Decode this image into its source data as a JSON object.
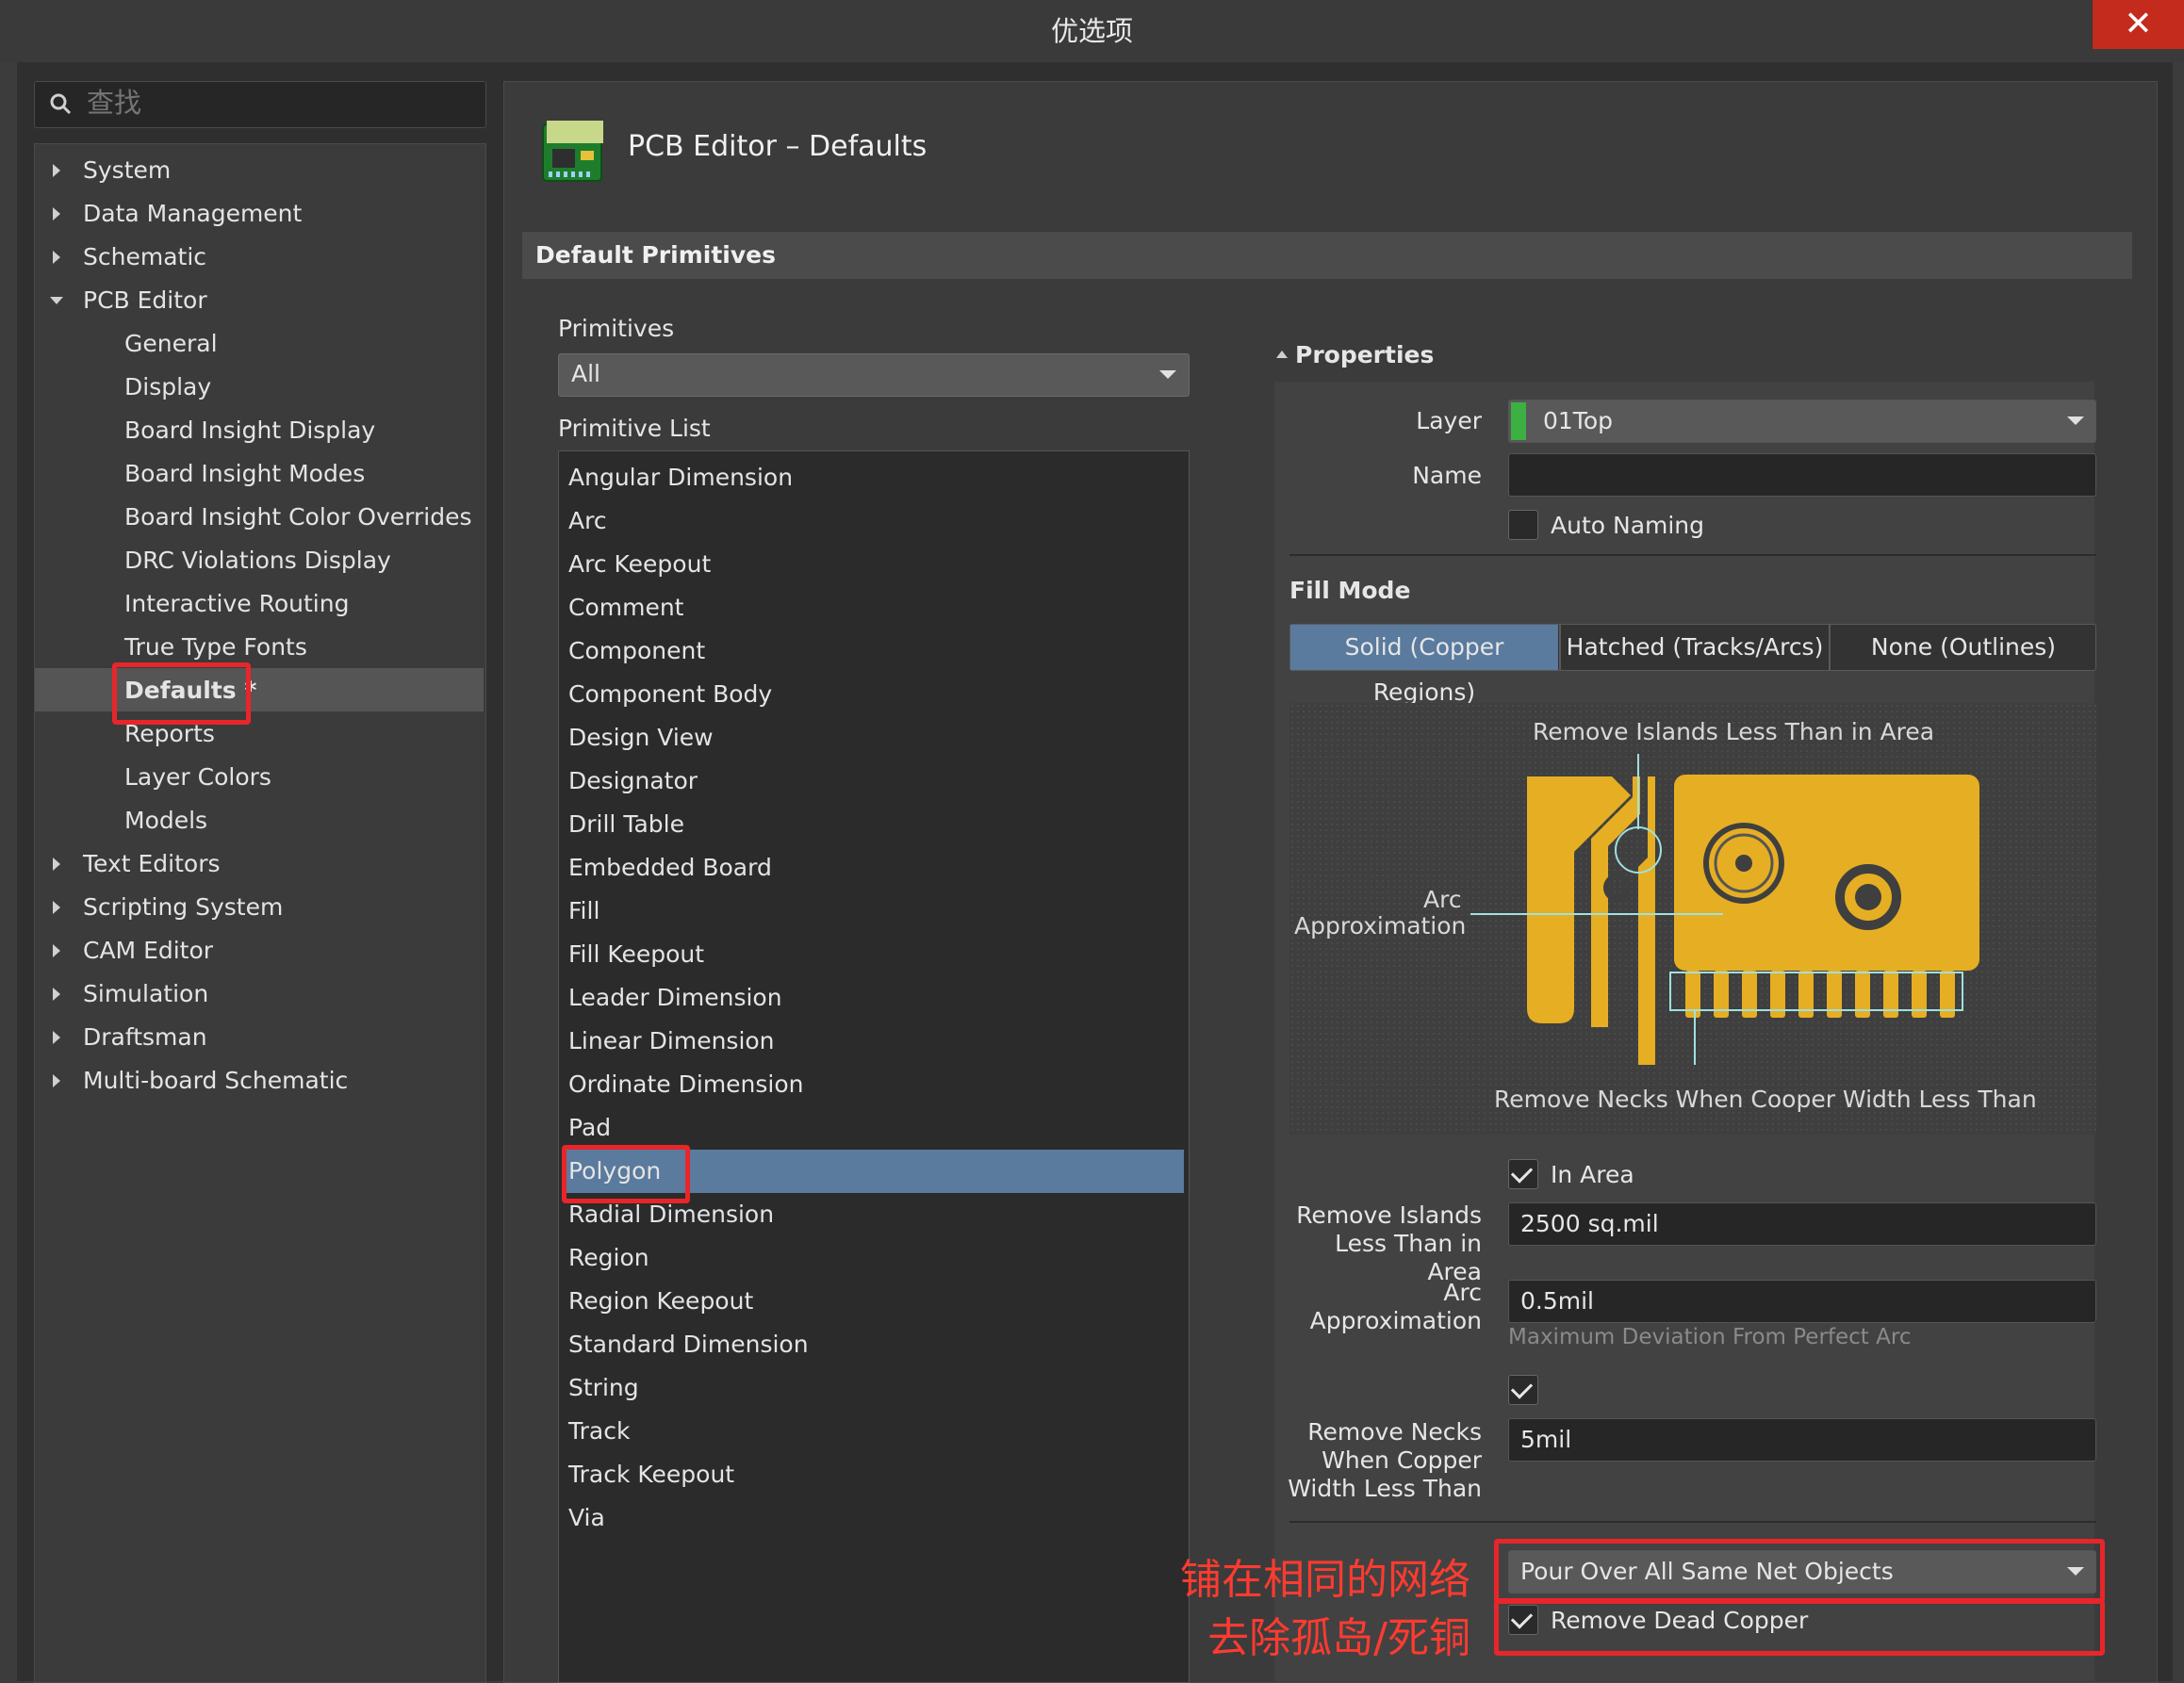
{
  "window": {
    "title": "优选项",
    "close_glyph": "✕"
  },
  "search": {
    "placeholder": "查找"
  },
  "tree": {
    "items": [
      {
        "label": "System",
        "level": 0,
        "expanded": false
      },
      {
        "label": "Data Management",
        "level": 0,
        "expanded": false
      },
      {
        "label": "Schematic",
        "level": 0,
        "expanded": false
      },
      {
        "label": "PCB Editor",
        "level": 0,
        "expanded": true
      },
      {
        "label": "General",
        "level": 1
      },
      {
        "label": "Display",
        "level": 1
      },
      {
        "label": "Board Insight Display",
        "level": 1
      },
      {
        "label": "Board Insight Modes",
        "level": 1
      },
      {
        "label": "Board Insight Color Overrides",
        "level": 1
      },
      {
        "label": "DRC Violations Display",
        "level": 1
      },
      {
        "label": "Interactive Routing",
        "level": 1
      },
      {
        "label": "True Type Fonts",
        "level": 1
      },
      {
        "label": "Defaults *",
        "level": 1,
        "selected": true
      },
      {
        "label": "Reports",
        "level": 1
      },
      {
        "label": "Layer Colors",
        "level": 1
      },
      {
        "label": "Models",
        "level": 1
      },
      {
        "label": "Text Editors",
        "level": 0,
        "expanded": false
      },
      {
        "label": "Scripting System",
        "level": 0,
        "expanded": false
      },
      {
        "label": "CAM Editor",
        "level": 0,
        "expanded": false
      },
      {
        "label": "Simulation",
        "level": 0,
        "expanded": false
      },
      {
        "label": "Draftsman",
        "level": 0,
        "expanded": false
      },
      {
        "label": "Multi-board Schematic",
        "level": 0,
        "expanded": false
      }
    ]
  },
  "header": {
    "title": "PCB Editor – Defaults"
  },
  "section": {
    "title": "Default Primitives"
  },
  "primitives": {
    "label": "Primitives",
    "selected": "All"
  },
  "primitive_list": {
    "label": "Primitive List",
    "items": [
      "Angular Dimension",
      "Arc",
      "Arc Keepout",
      "Comment",
      "Component",
      "Component Body",
      "Design View",
      "Designator",
      "Drill Table",
      "Embedded Board",
      "Fill",
      "Fill Keepout",
      "Leader Dimension",
      "Linear Dimension",
      "Ordinate Dimension",
      "Pad",
      "Polygon",
      "Radial Dimension",
      "Region",
      "Region Keepout",
      "Standard Dimension",
      "String",
      "Track",
      "Track Keepout",
      "Via"
    ],
    "selected": "Polygon"
  },
  "properties": {
    "title": "Properties",
    "layer_label": "Layer",
    "layer_value": "01Top",
    "layer_color": "#3cb043",
    "name_label": "Name",
    "name_value": "",
    "auto_naming_label": "Auto Naming",
    "auto_naming_checked": false,
    "fill_mode_title": "Fill Mode",
    "fill_modes": [
      "Solid (Copper Regions)",
      "Hatched (Tracks/Arcs)",
      "None (Outlines)"
    ],
    "fill_mode_selected": "Solid (Copper Regions)",
    "diagram": {
      "top_caption": "Remove Islands Less Than in Area",
      "left_caption_1": "Arc",
      "left_caption_2": "Approximation",
      "bottom_caption": "Remove Necks When Cooper Width Less Than",
      "copper_color": "#e6ae22",
      "callout_color": "#9fe0e0"
    },
    "in_area_label": "In Area",
    "in_area_checked": true,
    "islands_label_1": "Remove Islands",
    "islands_label_2": "Less Than in Area",
    "islands_value": "2500 sq.mil",
    "arc_label_1": "Arc",
    "arc_label_2": "Approximation",
    "arc_value": "0.5mil",
    "arc_hint": "Maximum Deviation From Perfect Arc",
    "necks_checked": true,
    "necks_label_1": "Remove Necks",
    "necks_label_2": "When Copper",
    "necks_label_3": "Width Less Than",
    "necks_value": "5mil",
    "pour_value": "Pour Over All Same Net Objects",
    "dead_copper_label": "Remove Dead Copper",
    "dead_copper_checked": true
  },
  "annotations": {
    "line1": "铺在相同的网络",
    "line2": "去除孤岛/死铜",
    "color": "#e8262a"
  }
}
